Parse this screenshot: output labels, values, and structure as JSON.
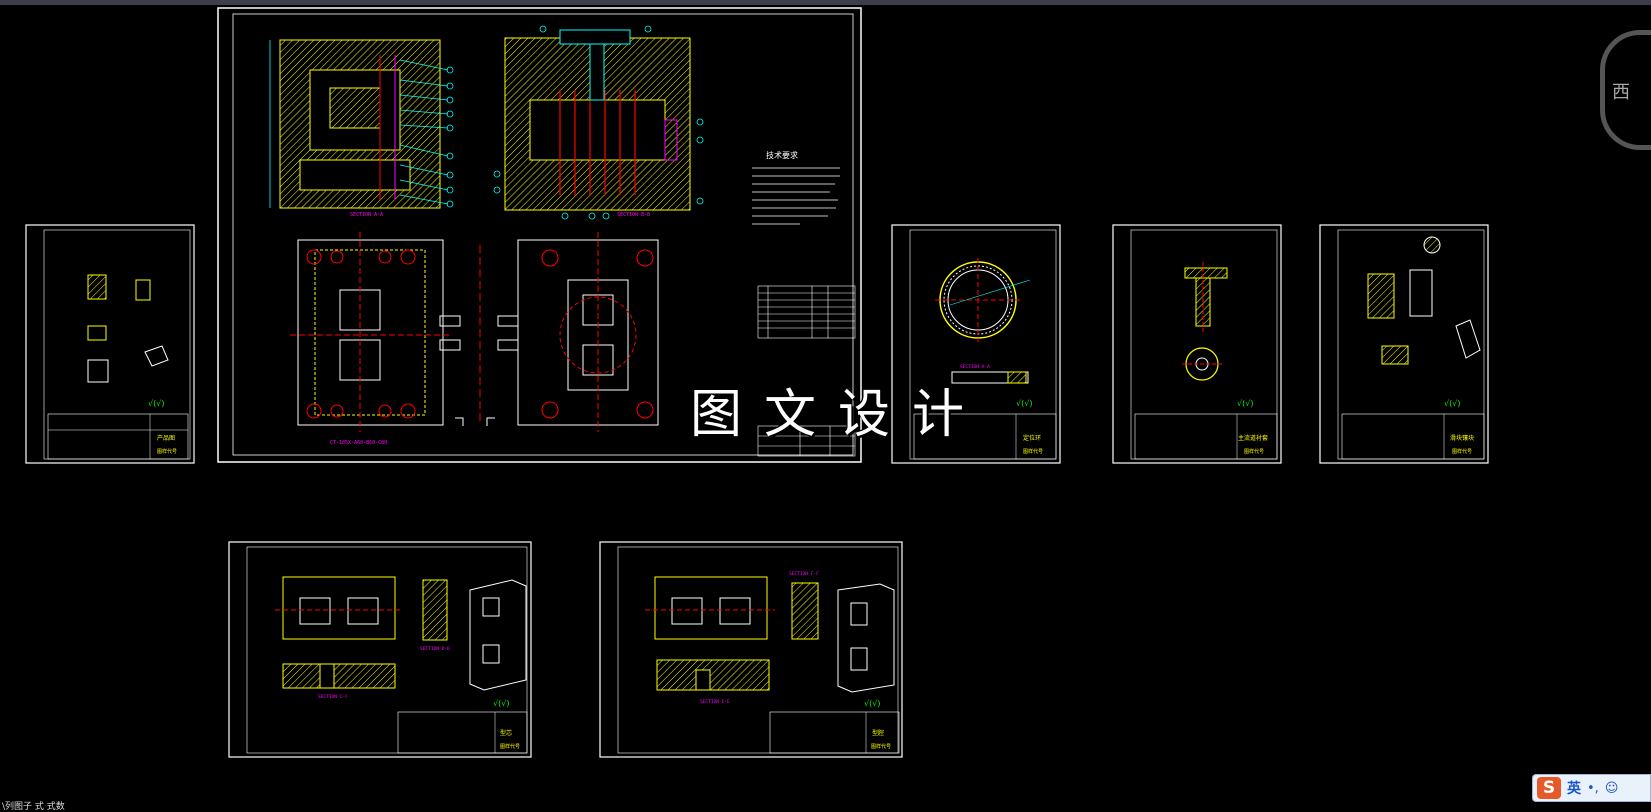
{
  "app": {
    "name": "CAD drawing viewer"
  },
  "watermark": "图文设计",
  "status_text": "\\列图子    式    式数",
  "viewcube": {
    "label": "西"
  },
  "ime": {
    "logo": "S",
    "lang": "英",
    "punct": "•,",
    "emoji": "☺"
  },
  "colors": {
    "background": "#000000",
    "frame": "#ffffff",
    "yellow": "#ffff00",
    "cyan": "#00ffff",
    "red": "#ff0000",
    "green": "#00ff00",
    "magenta": "#ff00ff"
  },
  "sheets": {
    "assembly": {
      "heading": "技术要求",
      "section_a": "SECTION A-A",
      "section_b": "SECTION B-B"
    },
    "product": {
      "part_label": "产品图",
      "code_label": "图样代号"
    },
    "ring": {
      "part_label": "定位环",
      "code_label": "图样代号",
      "section": "SECTION A-A"
    },
    "sprue": {
      "part_label": "主流道衬套",
      "code_label": "图样代号"
    },
    "slider": {
      "part_label": "滑块镶块",
      "code_label": "图样代号"
    },
    "core": {
      "part_label": "型芯",
      "code_label": "图样代号",
      "section_cc": "SECTION C-C",
      "section_dd": "SECTION D-D"
    },
    "cavity": {
      "part_label": "型腔",
      "code_label": "图样代号",
      "section_ee": "SECTION E-E",
      "section_ff": "SECTION F-F"
    }
  }
}
